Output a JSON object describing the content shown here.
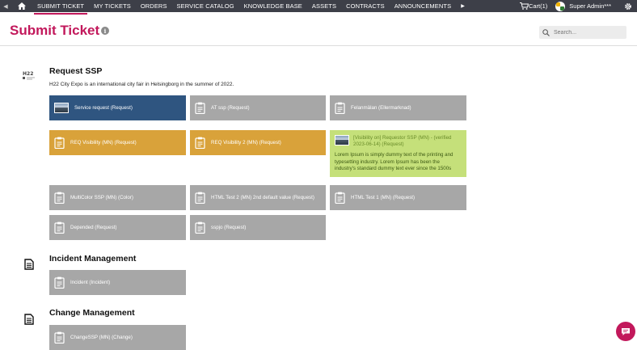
{
  "nav": {
    "items": [
      {
        "label": "SUBMIT TICKET",
        "active": true
      },
      {
        "label": "MY TICKETS"
      },
      {
        "label": "ORDERS"
      },
      {
        "label": "SERVICE CATALOG"
      },
      {
        "label": "KNOWLEDGE BASE"
      },
      {
        "label": "ASSETS"
      },
      {
        "label": "CONTRACTS"
      },
      {
        "label": "ANNOUNCEMENTS"
      }
    ],
    "cart_label": "Cart(1)",
    "user_name": "Super Admin***"
  },
  "header": {
    "title": "Submit Ticket",
    "info_glyph": "i",
    "search_placeholder": "Search..."
  },
  "sections": [
    {
      "title": "Request SSP",
      "description": "H22 City Expo is an international city fair in Helsingborg in the summer of 2022.",
      "tiles": [
        {
          "label": "Service request (Request)",
          "style": "blue"
        },
        {
          "label": "AT ssp (Request)",
          "style": "gray"
        },
        {
          "label": "Felanmälan (Ellermarknad)",
          "style": "gray"
        },
        {
          "label": "REQ Visibility (MN) (Request)",
          "style": "orange"
        },
        {
          "label": "REQ Visibility 2 (MN) (Request)",
          "style": "orange"
        },
        {
          "label_lines": [
            "[Visibility on] Requestor SSP (MN) - (verified",
            "2023-06-14) (Request)"
          ],
          "description_lines": [
            "Lorem Ipsum is simply dummy text of the printing and",
            "typesetting industry. Lorem Ipsum has been the",
            "industry's standard dummy text ever since the 1500s"
          ],
          "style": "green"
        },
        {
          "label": "MultiColor SSP (MN) (Color)",
          "style": "gray"
        },
        {
          "label": "HTML Test 2 (MN) 2nd default value (Request)",
          "style": "gray"
        },
        {
          "label": "HTML Test 1 (MN) (Request)",
          "style": "gray"
        },
        {
          "label": "Depended (Request)",
          "style": "gray"
        },
        {
          "label": "sspjo (Request)",
          "style": "gray"
        }
      ]
    },
    {
      "title": "Incident Management",
      "tiles": [
        {
          "label": "Incident (Incident)",
          "style": "gray"
        }
      ]
    },
    {
      "title": "Change Management",
      "tiles": [
        {
          "label": "ChangeSSP (MN) (Change)",
          "style": "gray"
        }
      ]
    }
  ],
  "colors": {
    "accent": "#c2185b",
    "nav_bg": "#3d3f48",
    "tile_gray": "#a7a7a7",
    "tile_blue": "#2f5580",
    "tile_orange": "#d9a23a",
    "tile_green": "#c5e07a"
  }
}
